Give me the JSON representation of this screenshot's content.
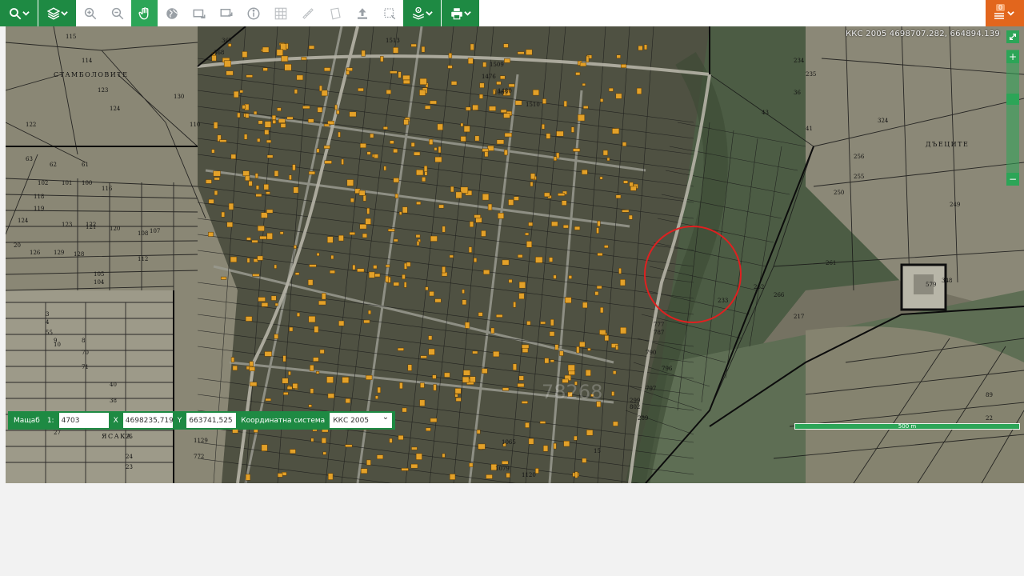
{
  "toolbar": {
    "tools": [
      {
        "name": "search-icon",
        "label": "Search"
      },
      {
        "name": "layers-icon",
        "label": "Layers"
      },
      {
        "name": "zoom-in-icon",
        "label": "Zoom in"
      },
      {
        "name": "zoom-out-icon",
        "label": "Zoom out"
      },
      {
        "name": "pan-hand-icon",
        "label": "Pan"
      },
      {
        "name": "globe-icon",
        "label": "Full extent"
      },
      {
        "name": "previous-extent-icon",
        "label": "Previous view"
      },
      {
        "name": "next-extent-icon",
        "label": "Next view"
      },
      {
        "name": "info-icon",
        "label": "Identify"
      },
      {
        "name": "grid-select-icon",
        "label": "Select by area"
      },
      {
        "name": "ruler-icon",
        "label": "Measure distance"
      },
      {
        "name": "polygon-icon",
        "label": "Measure area"
      },
      {
        "name": "upload-icon",
        "label": "Upload"
      },
      {
        "name": "select-box-icon",
        "label": "Box select"
      },
      {
        "name": "info-layers-icon",
        "label": "Layer info"
      },
      {
        "name": "print-icon",
        "label": "Print"
      }
    ],
    "notification_count": "0"
  },
  "map": {
    "coordinate_readout": "ККС 2005 4698707.282, 664894.139",
    "watermark": "78268",
    "scale_bar_label": "500 m",
    "labels": {
      "region_top_left": "СТАМБОЛОВИТЕ",
      "region_right": "ДЪЕЦИТЕ",
      "region_bottom_left": "ЯСАКА"
    },
    "parcel_numbers": [
      "115",
      "114",
      "123",
      "124",
      "122",
      "110",
      "130",
      "367",
      "368",
      "63",
      "62",
      "61",
      "102",
      "101",
      "100",
      "116",
      "118",
      "119",
      "124",
      "123",
      "122",
      "121",
      "120",
      "107",
      "108",
      "126",
      "129",
      "128",
      "112",
      "105",
      "104",
      "20",
      "3",
      "4",
      "55",
      "9",
      "8",
      "10",
      "70",
      "71",
      "40",
      "38",
      "27",
      "25",
      "24",
      "23",
      "4703",
      "233",
      "234",
      "235",
      "36",
      "43",
      "41",
      "324",
      "256",
      "255",
      "250",
      "249",
      "261",
      "262",
      "266",
      "348",
      "217",
      "579",
      "1513",
      "1480",
      "1509",
      "1510",
      "1476",
      "1063",
      "1065",
      "1079",
      "1120",
      "1129",
      "772",
      "777",
      "787",
      "790",
      "796",
      "797",
      "299",
      "289",
      "802",
      "15",
      "89",
      "22"
    ]
  },
  "coord_bar": {
    "scale_label": "Мащаб",
    "scale_prefix": "1:",
    "scale_value": "4703",
    "x_label": "X",
    "x_value": "4698235,719",
    "y_label": "Y",
    "y_value": "663741,525",
    "system_label": "Координатна система",
    "system_value": "ККС 2005"
  },
  "colors": {
    "toolbar_green": "#1e8a43",
    "active_green": "#2ca557",
    "orange": "#e2661d",
    "parcel_line": "#1b1b1b",
    "building_fill": "#e3a129",
    "highlight_circle": "#e02020"
  }
}
